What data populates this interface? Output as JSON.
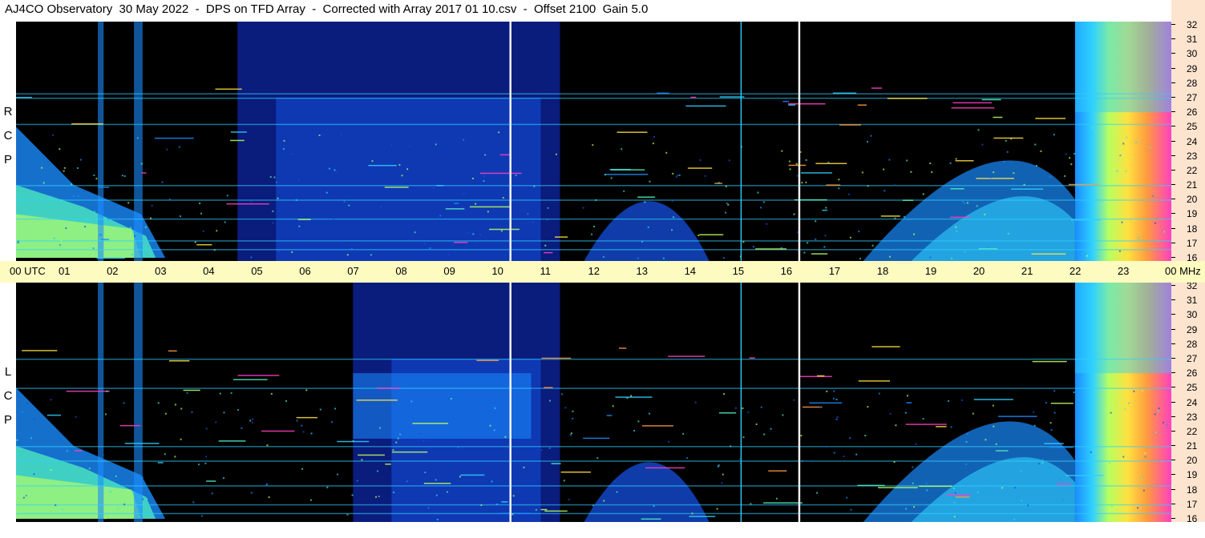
{
  "header": {
    "title": "AJ4CO Observatory  30 May 2022  -  DPS on TFD Array  -  Corrected with Array 2017 01 10.csv  -  Offset 2100  Gain 5.0"
  },
  "panels": {
    "rcp_label": "R\nC\nP",
    "lcp_label": "L\nC\nP"
  },
  "chart_data": {
    "type": "heatmap",
    "title": "AJ4CO Observatory  30 May 2022  -  DPS on TFD Array  -  Corrected with Array 2017 01 10.csv  -  Offset 2100  Gain 5.0",
    "x_axis": {
      "unit": "UTC",
      "range": [
        0,
        24
      ],
      "tick_labels": [
        "00 UTC",
        "01",
        "02",
        "03",
        "04",
        "05",
        "06",
        "07",
        "08",
        "09",
        "10",
        "11",
        "12",
        "13",
        "14",
        "15",
        "16",
        "17",
        "18",
        "19",
        "20",
        "21",
        "22",
        "23",
        "00 MHz"
      ]
    },
    "y_axis": {
      "unit": "MHz",
      "range": [
        16,
        32
      ],
      "tick_labels": [
        "32",
        "31",
        "30",
        "29",
        "28",
        "27",
        "26",
        "25",
        "24",
        "23",
        "22",
        "21",
        "20",
        "19",
        "18",
        "17",
        "16"
      ]
    },
    "panels": [
      "R C P",
      "L C P"
    ],
    "colormap": [
      "#000000",
      "#0b1f8a",
      "#1450e0",
      "#1a8cff",
      "#2fd0ff",
      "#4ff0c0",
      "#b8ff60",
      "#ffe040",
      "#ff9a40",
      "#ff40c0"
    ],
    "colors": {
      "axis_bar": "#fdfbc0",
      "freq_axis_bg": "#fde4cf",
      "plot_bg": "#000000"
    }
  }
}
